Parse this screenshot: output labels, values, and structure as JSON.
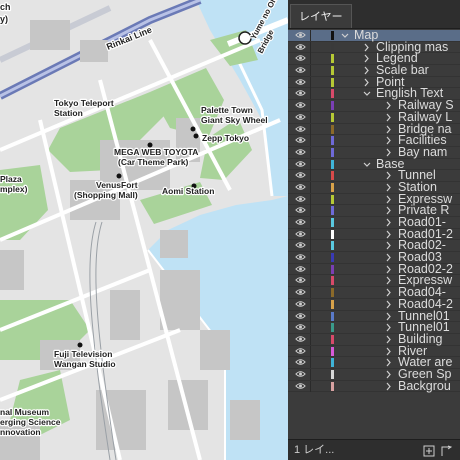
{
  "map": {
    "labels": {
      "rinkai_line": "Rinkai Line",
      "yume_bridge_1": "Yume no Ohashi",
      "yume_bridge_2": "Bridge",
      "tokyo_teleport_1": "Tokyo Teleport",
      "tokyo_teleport_2": "Station",
      "palette_town_1": "Palette Town",
      "palette_town_2": "Giant Sky Wheel",
      "zepp_tokyo": "Zepp Tokyo",
      "mega_web_1": "MEGA WEB TOYOTA",
      "mega_web_2": "(Car Theme Park)",
      "venusfort_1": "VenusFort",
      "venusfort_2": "(Shopping Mall)",
      "aomi_station": "Aomi Station",
      "plaza_1": "Plaza",
      "plaza_2": "mplex)",
      "fuji_tv_1": "Fuji Television",
      "fuji_tv_2": "Wangan Studio",
      "museum_1": "nal Museum",
      "museum_2": "erging Science",
      "museum_3": "nnovation",
      "topleft_1": "ch",
      "topleft_2": "y)"
    }
  },
  "panel": {
    "tab_title": "レイヤー",
    "footer_label": "1 レイ...",
    "layers": [
      {
        "name": "Map",
        "indent": 0,
        "color": "#111111",
        "expanded": true,
        "selected": true
      },
      {
        "name": "Clipping mas",
        "indent": 1,
        "color": "#3a3a3a",
        "expanded": false
      },
      {
        "name": "Legend",
        "indent": 1,
        "color": "#b6c935",
        "expanded": false
      },
      {
        "name": "Scale bar",
        "indent": 1,
        "color": "#b6c935",
        "expanded": false
      },
      {
        "name": "Point",
        "indent": 1,
        "color": "#b6c935",
        "expanded": false
      },
      {
        "name": "English Text",
        "indent": 1,
        "color": "#d84a6a",
        "expanded": true
      },
      {
        "name": "Railway S",
        "indent": 2,
        "color": "#7a3fb4",
        "expanded": false
      },
      {
        "name": "Railway L",
        "indent": 2,
        "color": "#b6c935",
        "expanded": false
      },
      {
        "name": "Bridge na",
        "indent": 2,
        "color": "#8b6a2a",
        "expanded": false
      },
      {
        "name": "Facilities",
        "indent": 2,
        "color": "#6f6ad8",
        "expanded": false
      },
      {
        "name": "Bay nam",
        "indent": 2,
        "color": "#6f6ad8",
        "expanded": false
      },
      {
        "name": "Base",
        "indent": 1,
        "color": "#3fb4d8",
        "expanded": true
      },
      {
        "name": "Tunnel",
        "indent": 2,
        "color": "#d84a4a",
        "expanded": false
      },
      {
        "name": "Station",
        "indent": 2,
        "color": "#d8a24a",
        "expanded": false
      },
      {
        "name": "Expressw",
        "indent": 2,
        "color": "#b6c935",
        "expanded": false
      },
      {
        "name": "Private R",
        "indent": 2,
        "color": "#6f6ad8",
        "expanded": false
      },
      {
        "name": "Road01-",
        "indent": 2,
        "color": "#5ac9e0",
        "expanded": false
      },
      {
        "name": "Road01-2",
        "indent": 2,
        "color": "#ffffff",
        "expanded": false
      },
      {
        "name": "Road02-",
        "indent": 2,
        "color": "#5ac9e0",
        "expanded": false
      },
      {
        "name": "Road03",
        "indent": 2,
        "color": "#3a3ab4",
        "expanded": false
      },
      {
        "name": "Road02-2",
        "indent": 2,
        "color": "#7a3fb4",
        "expanded": false
      },
      {
        "name": "Expressw",
        "indent": 2,
        "color": "#d84a6a",
        "expanded": false
      },
      {
        "name": "Road04-",
        "indent": 2,
        "color": "#8b6a2a",
        "expanded": false
      },
      {
        "name": "Road04-2",
        "indent": 2,
        "color": "#d8a24a",
        "expanded": false
      },
      {
        "name": "Tunnel01",
        "indent": 2,
        "color": "#5a7ac9",
        "expanded": false
      },
      {
        "name": "Tunnel01",
        "indent": 2,
        "color": "#3a9a8a",
        "expanded": false
      },
      {
        "name": "Building",
        "indent": 2,
        "color": "#d84a6a",
        "expanded": false
      },
      {
        "name": "River",
        "indent": 2,
        "color": "#d85ad8",
        "expanded": false
      },
      {
        "name": "Water are",
        "indent": 2,
        "color": "#3fb4d8",
        "expanded": false
      },
      {
        "name": "Green Sp",
        "indent": 2,
        "color": "#d8d8d8",
        "expanded": false
      },
      {
        "name": "Backgrou",
        "indent": 2,
        "color": "#d8a2a2",
        "expanded": false
      }
    ]
  }
}
